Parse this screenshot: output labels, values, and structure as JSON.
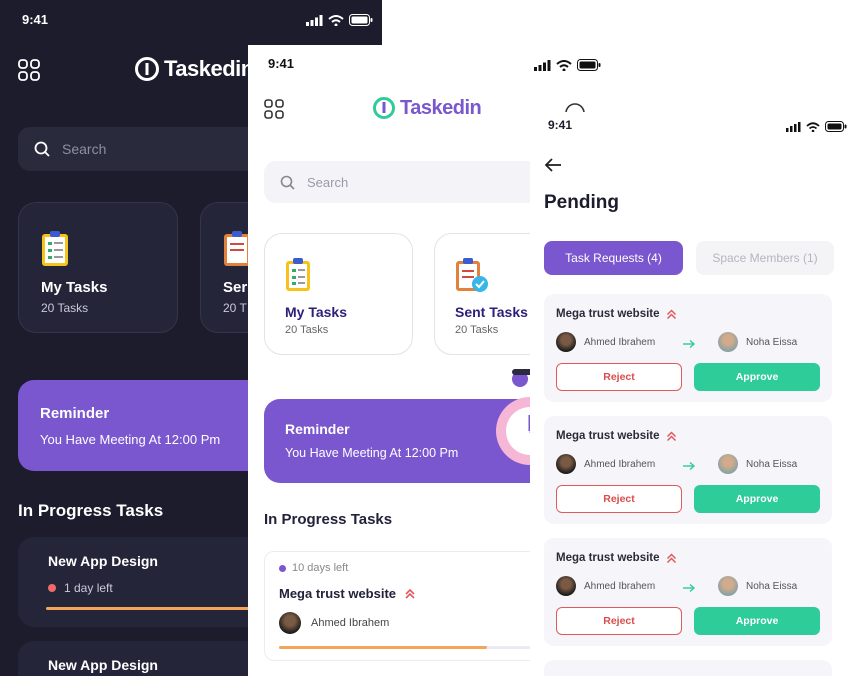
{
  "brand": {
    "name": "Taskedin",
    "accent": "#7a56cf",
    "teal": "#2ecc98"
  },
  "status": {
    "time": "9:41"
  },
  "dark_screen": {
    "search_placeholder": "Search",
    "cards": [
      {
        "title": "My Tasks",
        "sub": "20 Tasks",
        "icon": "clipboard-icon"
      },
      {
        "title": "Ser",
        "sub": "20 T",
        "icon": "clipboard-check-icon"
      }
    ],
    "reminder": {
      "title": "Reminder",
      "text": "You Have Meeting At 12:00 Pm"
    },
    "section": "In Progress Tasks",
    "tasks": [
      {
        "title": "New App Design",
        "due": "1 day left",
        "progress": 0.85
      },
      {
        "title": "New App Design"
      }
    ]
  },
  "light_screen": {
    "search_placeholder": "Search",
    "cards": [
      {
        "title": "My Tasks",
        "sub": "20 Tasks",
        "icon": "clipboard-icon"
      },
      {
        "title": "Sent Tasks",
        "sub": "20 Tasks",
        "icon": "clipboard-check-icon"
      }
    ],
    "reminder": {
      "title": "Reminder",
      "text": "You Have Meeting At 12:00 Pm"
    },
    "section": "In Progress Tasks",
    "task": {
      "due": "10 days left",
      "title": "Mega trust website",
      "assignee": "Ahmed Ibrahem",
      "progress": 0.77
    }
  },
  "pending_screen": {
    "title": "Pending",
    "tabs": [
      "Task Requests (4)",
      "Space Members (1)"
    ],
    "requests": [
      {
        "title": "Mega trust website",
        "from": "Ahmed Ibrahem",
        "to": "Noha Eissa",
        "reject": "Reject",
        "approve": "Approve"
      },
      {
        "title": "Mega trust website",
        "from": "Ahmed Ibrahem",
        "to": "Noha Eissa",
        "reject": "Reject",
        "approve": "Approve"
      },
      {
        "title": "Mega trust website",
        "from": "Ahmed Ibrahem",
        "to": "Noha Eissa",
        "reject": "Reject",
        "approve": "Approve"
      }
    ]
  }
}
